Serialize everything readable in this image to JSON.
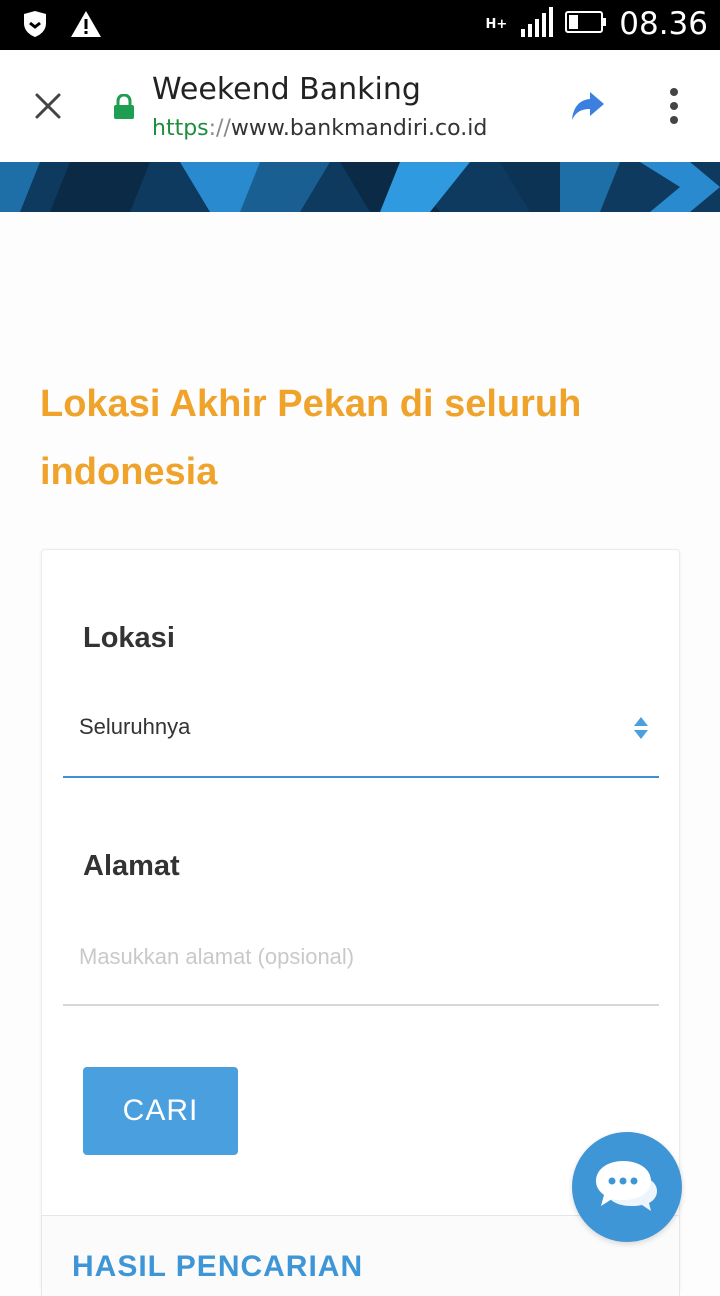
{
  "status_bar": {
    "time": "08.36",
    "network": "H+"
  },
  "browser": {
    "title": "Weekend Banking",
    "url_scheme": "https",
    "url_sep": "://",
    "url_host": "www.bankmandiri.co.id"
  },
  "page": {
    "heading": "Lokasi Akhir Pekan di seluruh indonesia",
    "form": {
      "location_label": "Lokasi",
      "location_value": "Seluruhnya",
      "address_label": "Alamat",
      "address_placeholder": "Masukkan alamat (opsional)",
      "address_value": "",
      "search_button": "CARI"
    },
    "results_title": "HASIL PENCARIAN"
  },
  "colors": {
    "heading": "#f0a32a",
    "accent_blue": "#4aa0df",
    "lock_green": "#1e9e50"
  }
}
